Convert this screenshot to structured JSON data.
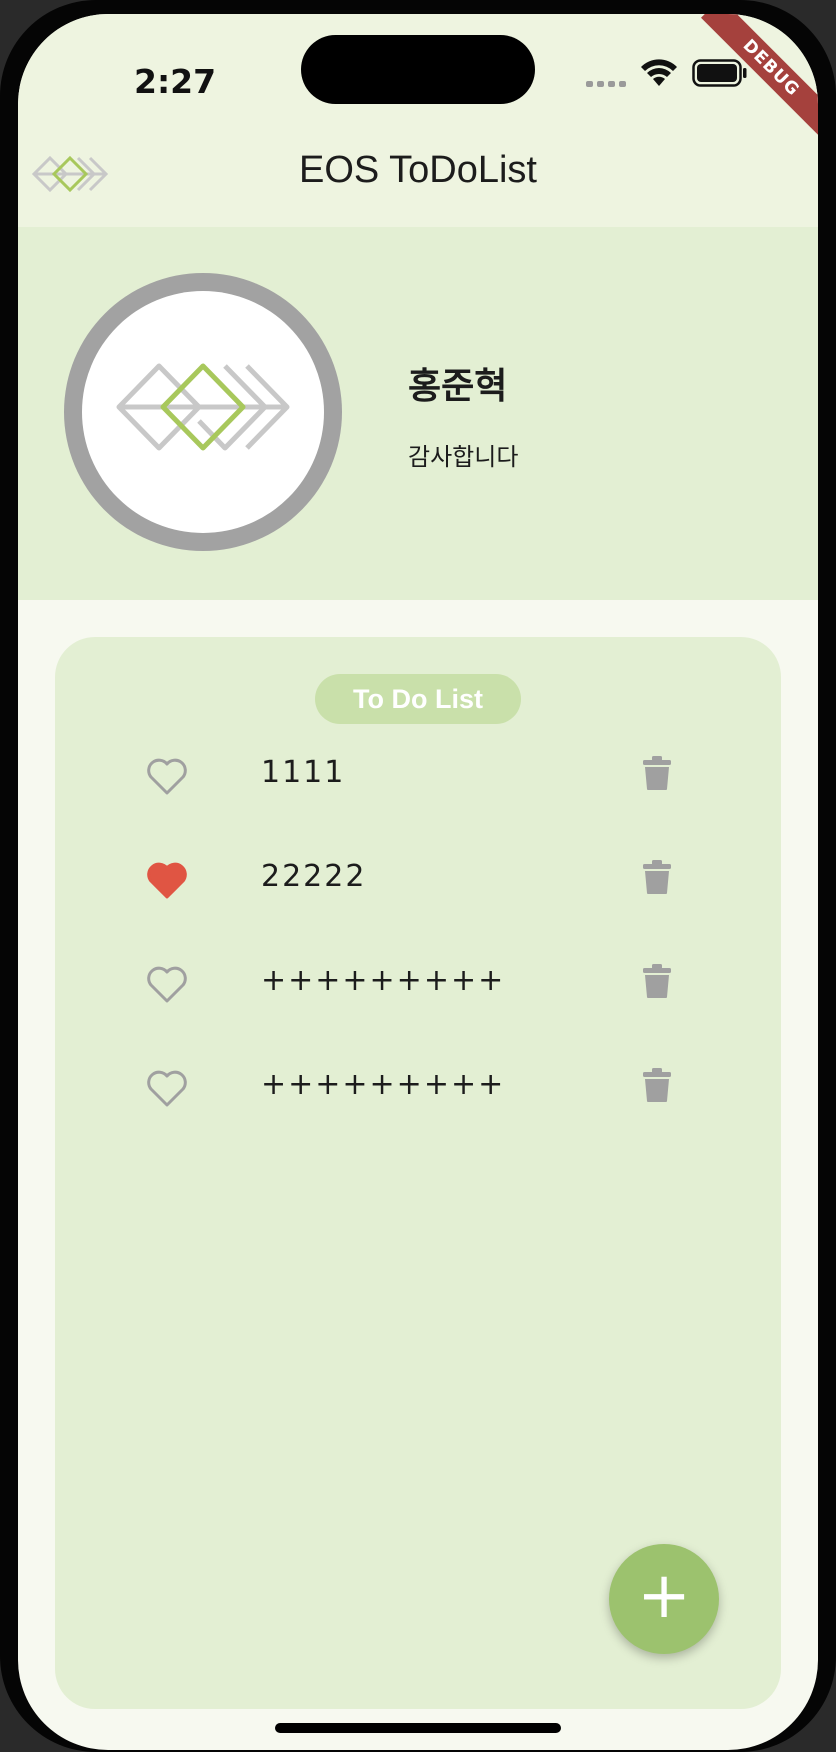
{
  "status_bar": {
    "time": "2:27",
    "debug_label": "DEBUG"
  },
  "app_bar": {
    "title": "EOS ToDoList",
    "logo_icon": "eos-diamond-logo-icon"
  },
  "profile": {
    "name": "홍준혁",
    "message": "감사합니다",
    "avatar_icon": "eos-diamond-logo-icon"
  },
  "todo": {
    "title": "To Do List",
    "items": [
      {
        "text": "1111",
        "liked": false
      },
      {
        "text": "22222",
        "liked": true
      },
      {
        "text": "+++++++++",
        "liked": false
      },
      {
        "text": "+++++++++",
        "liked": false
      }
    ]
  },
  "fab": {
    "label": "+",
    "icon": "add-icon"
  },
  "colors": {
    "app_bar_bg": "#eef4e0",
    "profile_bg": "#e3efd3",
    "card_bg": "#e3efd3",
    "pill_bg": "#c9e0aa",
    "fab_bg": "#9cc26e",
    "heart_liked": "#e05543",
    "icon_gray": "#a0a0a0",
    "debug_banner": "#a5413d"
  }
}
